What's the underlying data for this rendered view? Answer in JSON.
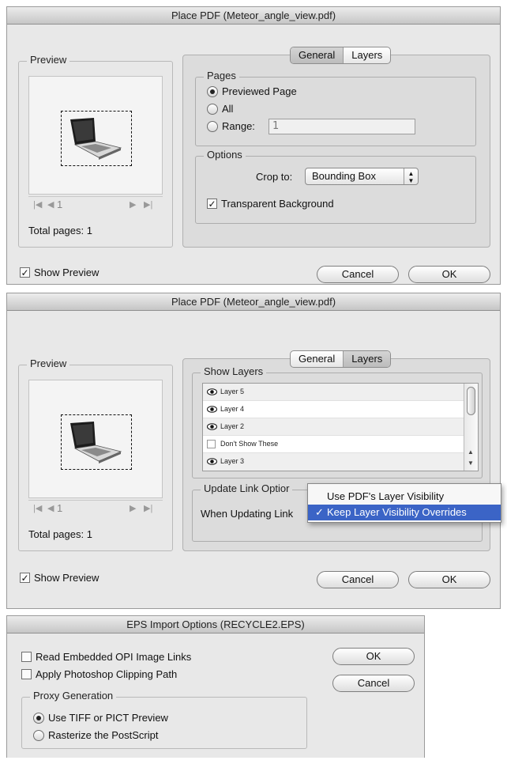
{
  "dialog1": {
    "title": "Place PDF (Meteor_angle_view.pdf)",
    "preview_label": "Preview",
    "page_number": "1",
    "total_pages": "Total pages: 1",
    "show_preview": "Show Preview",
    "tabs": [
      "General",
      "Layers"
    ],
    "active_tab": "General",
    "pages_label": "Pages",
    "radio_previewed": "Previewed Page",
    "radio_all": "All",
    "radio_range": "Range:",
    "range_value": "1",
    "options_label": "Options",
    "crop_label": "Crop to:",
    "crop_value": "Bounding Box",
    "transparent_bg": "Transparent Background",
    "cancel": "Cancel",
    "ok": "OK"
  },
  "dialog2": {
    "title": "Place PDF (Meteor_angle_view.pdf)",
    "preview_label": "Preview",
    "page_number": "1",
    "total_pages": "Total pages: 1",
    "show_preview": "Show Preview",
    "tabs": [
      "General",
      "Layers"
    ],
    "active_tab": "Layers",
    "show_layers_label": "Show Layers",
    "layers": [
      {
        "name": "Layer 5",
        "visible": true
      },
      {
        "name": "Layer 4",
        "visible": true
      },
      {
        "name": "Layer 2",
        "visible": true
      },
      {
        "name": "Don't Show These",
        "visible": false
      },
      {
        "name": "Layer 3",
        "visible": true
      }
    ],
    "update_link_label": "Update Link Optior",
    "when_updating_label": "When Updating Link",
    "menu_items": [
      "Use PDF's Layer Visibility",
      "Keep Layer Visibility Overrides"
    ],
    "menu_selected": "Keep Layer Visibility Overrides",
    "cancel": "Cancel",
    "ok": "OK"
  },
  "dialog3": {
    "title": "EPS Import Options (RECYCLE2.EPS)",
    "read_opi": "Read Embedded OPI Image Links",
    "apply_clipping": "Apply Photoshop Clipping Path",
    "proxy_label": "Proxy Generation",
    "radio_tiff": "Use TIFF or PICT Preview",
    "radio_rasterize": "Rasterize the PostScript",
    "ok": "OK",
    "cancel": "Cancel"
  },
  "icons": {
    "checked": "✓",
    "nav_first": "|◀",
    "nav_prev": "◀",
    "nav_next": "▶",
    "nav_last": "▶|"
  }
}
